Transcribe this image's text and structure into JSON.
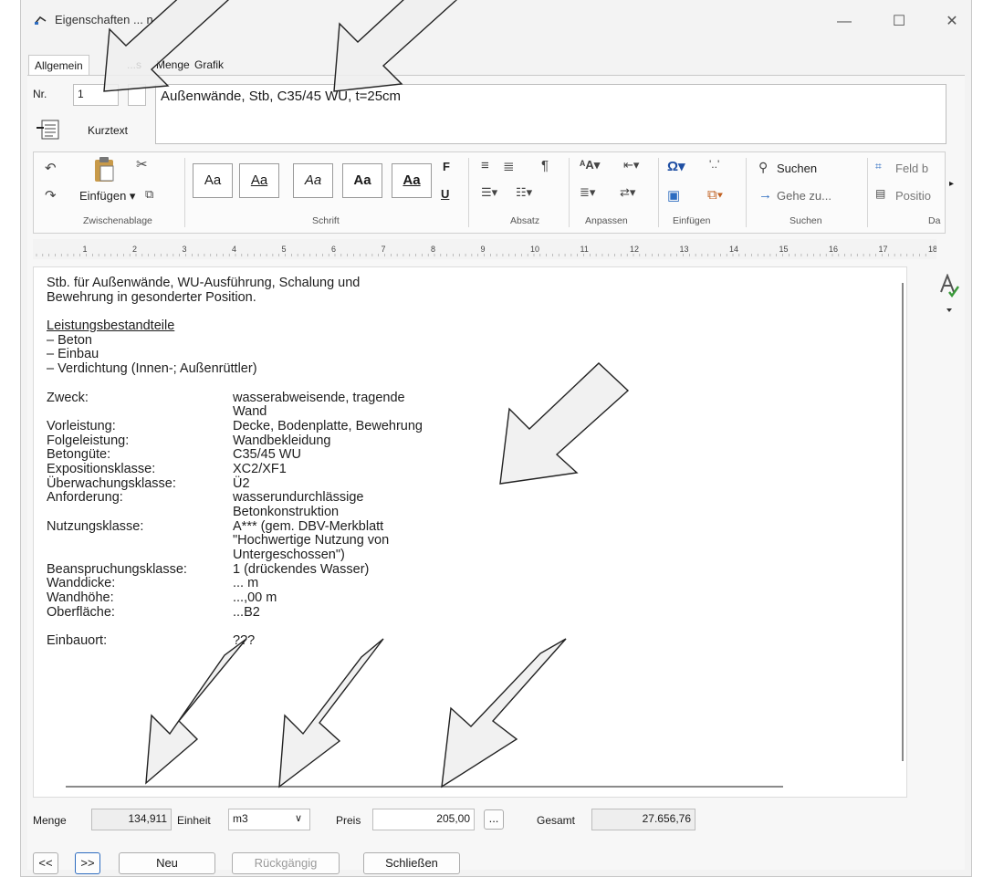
{
  "window": {
    "title": "Eigenschaften ... n",
    "controls": {
      "minimize": "—",
      "maximize": "☐",
      "close": "✕"
    }
  },
  "tabs": [
    {
      "label": "Allgemein",
      "active": true
    },
    {
      "label": "...s",
      "active": false
    },
    {
      "label": "Menge",
      "active": false
    },
    {
      "label": "Grafik",
      "active": false
    }
  ],
  "header": {
    "nr_label": "Nr.",
    "nr_value": "1",
    "nr_suffix": "",
    "title_text": "Außenwände, Stb, C35/45 WU, t=25cm",
    "kurztext_label": "Kurztext"
  },
  "ribbon": {
    "groups": {
      "zwischenablage": "Zwischenablage",
      "schrift": "Schrift",
      "absatz": "Absatz",
      "anpassen": "Anpassen",
      "einfuegen": "Einfügen",
      "suchen": "Suchen",
      "daten": "Da"
    },
    "einfuegen_btn": "Einfügen ▾",
    "styles": [
      "Aa",
      "Aa",
      "Aa",
      "Aa",
      "Aa"
    ],
    "bold": "F",
    "underline": "U",
    "suchen_btn": "Suchen",
    "gehezu_btn": "Gehe zu...",
    "feld_btn": "Feld b",
    "position_btn": "Positio"
  },
  "ruler": {
    "marks": [
      "1",
      "2",
      "3",
      "4",
      "5",
      "6",
      "7",
      "8",
      "9",
      "10",
      "11",
      "12",
      "13",
      "14",
      "15",
      "16",
      "17",
      "18"
    ]
  },
  "document": {
    "intro": [
      "Stb. für Außenwände, WU-Ausführung, Schalung und",
      "Bewehrung in gesonderter Position."
    ],
    "section_title": "Leistungsbestandteile",
    "items": [
      "–  Beton",
      "–  Einbau",
      "–  Verdichtung (Innen-; Außenrüttler)"
    ],
    "props": [
      {
        "key": "Zweck:",
        "lines": [
          "wasserabweisende, tragende",
          "Wand"
        ]
      },
      {
        "key": "Vorleistung:",
        "lines": [
          "Decke, Bodenplatte, Bewehrung"
        ]
      },
      {
        "key": "Folgeleistung:",
        "lines": [
          "Wandbekleidung"
        ]
      },
      {
        "key": "Betongüte:",
        "lines": [
          "C35/45 WU"
        ]
      },
      {
        "key": "Expositionsklasse:",
        "lines": [
          "XC2/XF1"
        ]
      },
      {
        "key": "Überwachungsklasse:",
        "lines": [
          "Ü2"
        ]
      },
      {
        "key": "Anforderung:",
        "lines": [
          "wasserundurchlässige",
          "Betonkonstruktion"
        ]
      },
      {
        "key": "Nutzungsklasse:",
        "lines": [
          "A*** (gem. DBV-Merkblatt",
          "\"Hochwertige Nutzung von",
          "Untergeschossen\")"
        ]
      },
      {
        "key": "Beanspruchungsklasse:",
        "lines": [
          "1 (drückendes Wasser)"
        ]
      },
      {
        "key": "Wanddicke:",
        "lines": [
          "... m"
        ]
      },
      {
        "key": "Wandhöhe:",
        "lines": [
          "...,00 m"
        ]
      },
      {
        "key": "Oberfläche:",
        "lines": [
          "...B2"
        ]
      }
    ],
    "einbauort_key": "Einbauort:",
    "einbauort_value": "???"
  },
  "footer": {
    "menge_label": "Menge",
    "menge_value": "134,911",
    "einheit_label": "Einheit",
    "einheit_value": "m3",
    "preis_label": "Preis",
    "preis_value": "205,00",
    "ellipsis": "...",
    "gesamt_label": "Gesamt",
    "gesamt_value": "27.656,76"
  },
  "buttons": {
    "prev": "<<",
    "next": ">>",
    "neu": "Neu",
    "rueckgaengig": "Rückgängig",
    "schliessen": "Schließen"
  }
}
